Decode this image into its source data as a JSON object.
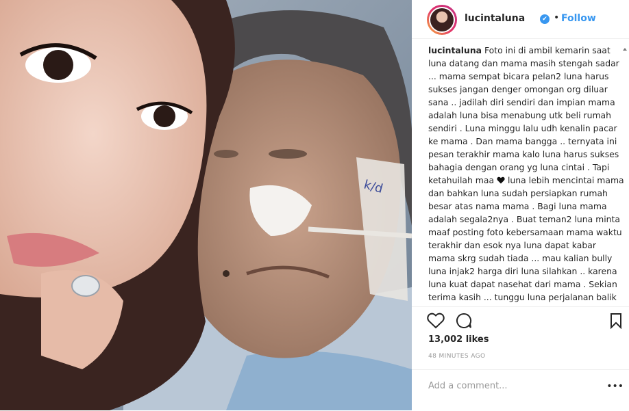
{
  "post": {
    "username": "lucintaluna",
    "follow_label": "Follow",
    "separator": "•",
    "verified_mark": "✔",
    "caption_user": "lucintaluna",
    "caption_before_heart": "Foto ini di ambil kemarin saat luna datang dan mama masih stengah sadar ... mama sempat bicara pelan2 luna harus sukses jangan denger omongan org diluar sana .. jadilah diri sendiri dan impian mama adalah luna bisa menabung utk beli rumah sendiri . Luna minggu lalu udh kenalin pacar ke mama . Dan mama bangga .. ternyata ini pesan terakhir mama kalo luna harus sukses bahagia dengan orang yg luna cintai . Tapi ketahuilah maa",
    "caption_after_heart": "luna lebih mencintai mama dan bahkan luna sudah persiapkan rumah besar atas nama mama . Bagi luna mama adalah segala2nya . Buat teman2 luna minta maaf posting foto kebersamaan mama waktu terakhir dan esok nya luna dapat kabar mama skrg sudah tiada ... mau kalian bully luna injak2 harga diri luna silahkan .. karena luna kuat dapat nasehat dari mama . Sekian terima kasih ... tunggu luna perjalanan balik dari",
    "likes": "13,002 likes",
    "time_ago": "48 MINUTES AGO",
    "comment_placeholder": "Add a comment...",
    "more_label": "•••"
  },
  "icons": {
    "like": "heart-outline-icon",
    "comment": "speech-bubble-icon",
    "save": "bookmark-icon",
    "caption_heart": "black-heart-emoji",
    "verified": "verified-badge-icon"
  },
  "colors": {
    "link_blue": "#3897f0",
    "text": "#262626",
    "muted": "#999999",
    "border": "#efefef"
  }
}
